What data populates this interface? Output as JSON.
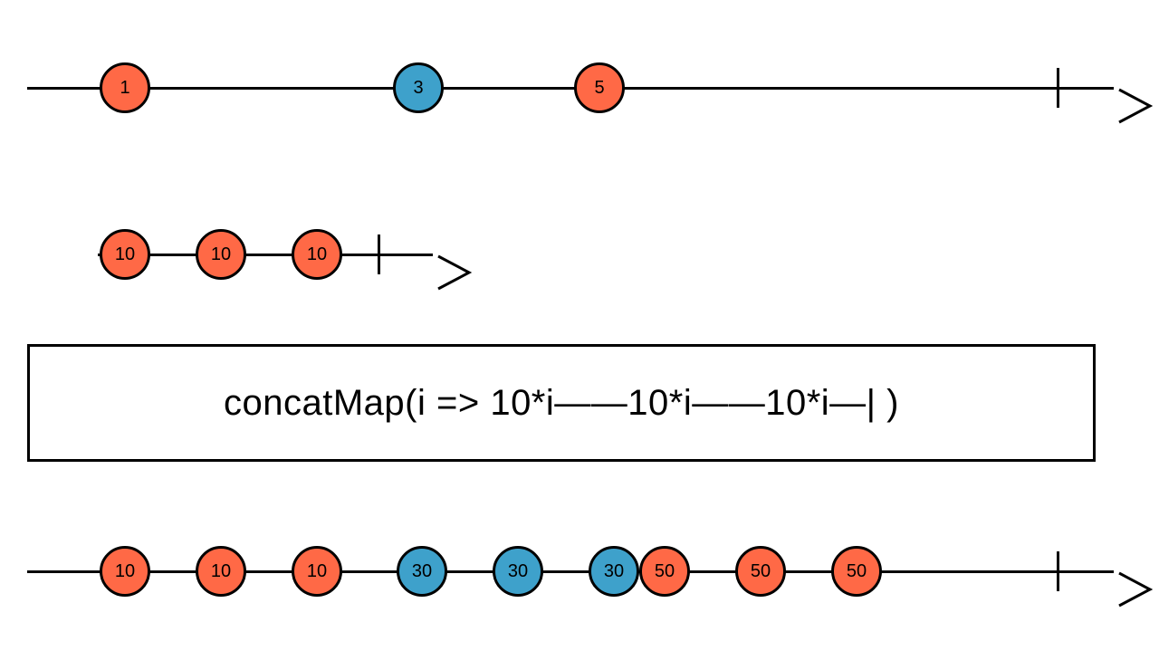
{
  "colors": {
    "orange": "#ff6946",
    "blue": "#3ea1cb"
  },
  "operator_label": "concatMap(i => 10*i——10*i——10*i—| )",
  "source": {
    "marbles": [
      {
        "value": "1",
        "color": "orange"
      },
      {
        "value": "3",
        "color": "blue"
      },
      {
        "value": "5",
        "color": "orange"
      }
    ]
  },
  "inner": {
    "marbles": [
      {
        "value": "10",
        "color": "orange"
      },
      {
        "value": "10",
        "color": "orange"
      },
      {
        "value": "10",
        "color": "orange"
      }
    ]
  },
  "output": {
    "marbles": [
      {
        "value": "10",
        "color": "orange"
      },
      {
        "value": "10",
        "color": "orange"
      },
      {
        "value": "10",
        "color": "orange"
      },
      {
        "value": "30",
        "color": "blue"
      },
      {
        "value": "30",
        "color": "blue"
      },
      {
        "value": "30",
        "color": "blue"
      },
      {
        "value": "50",
        "color": "orange"
      },
      {
        "value": "50",
        "color": "orange"
      },
      {
        "value": "50",
        "color": "orange"
      }
    ]
  }
}
